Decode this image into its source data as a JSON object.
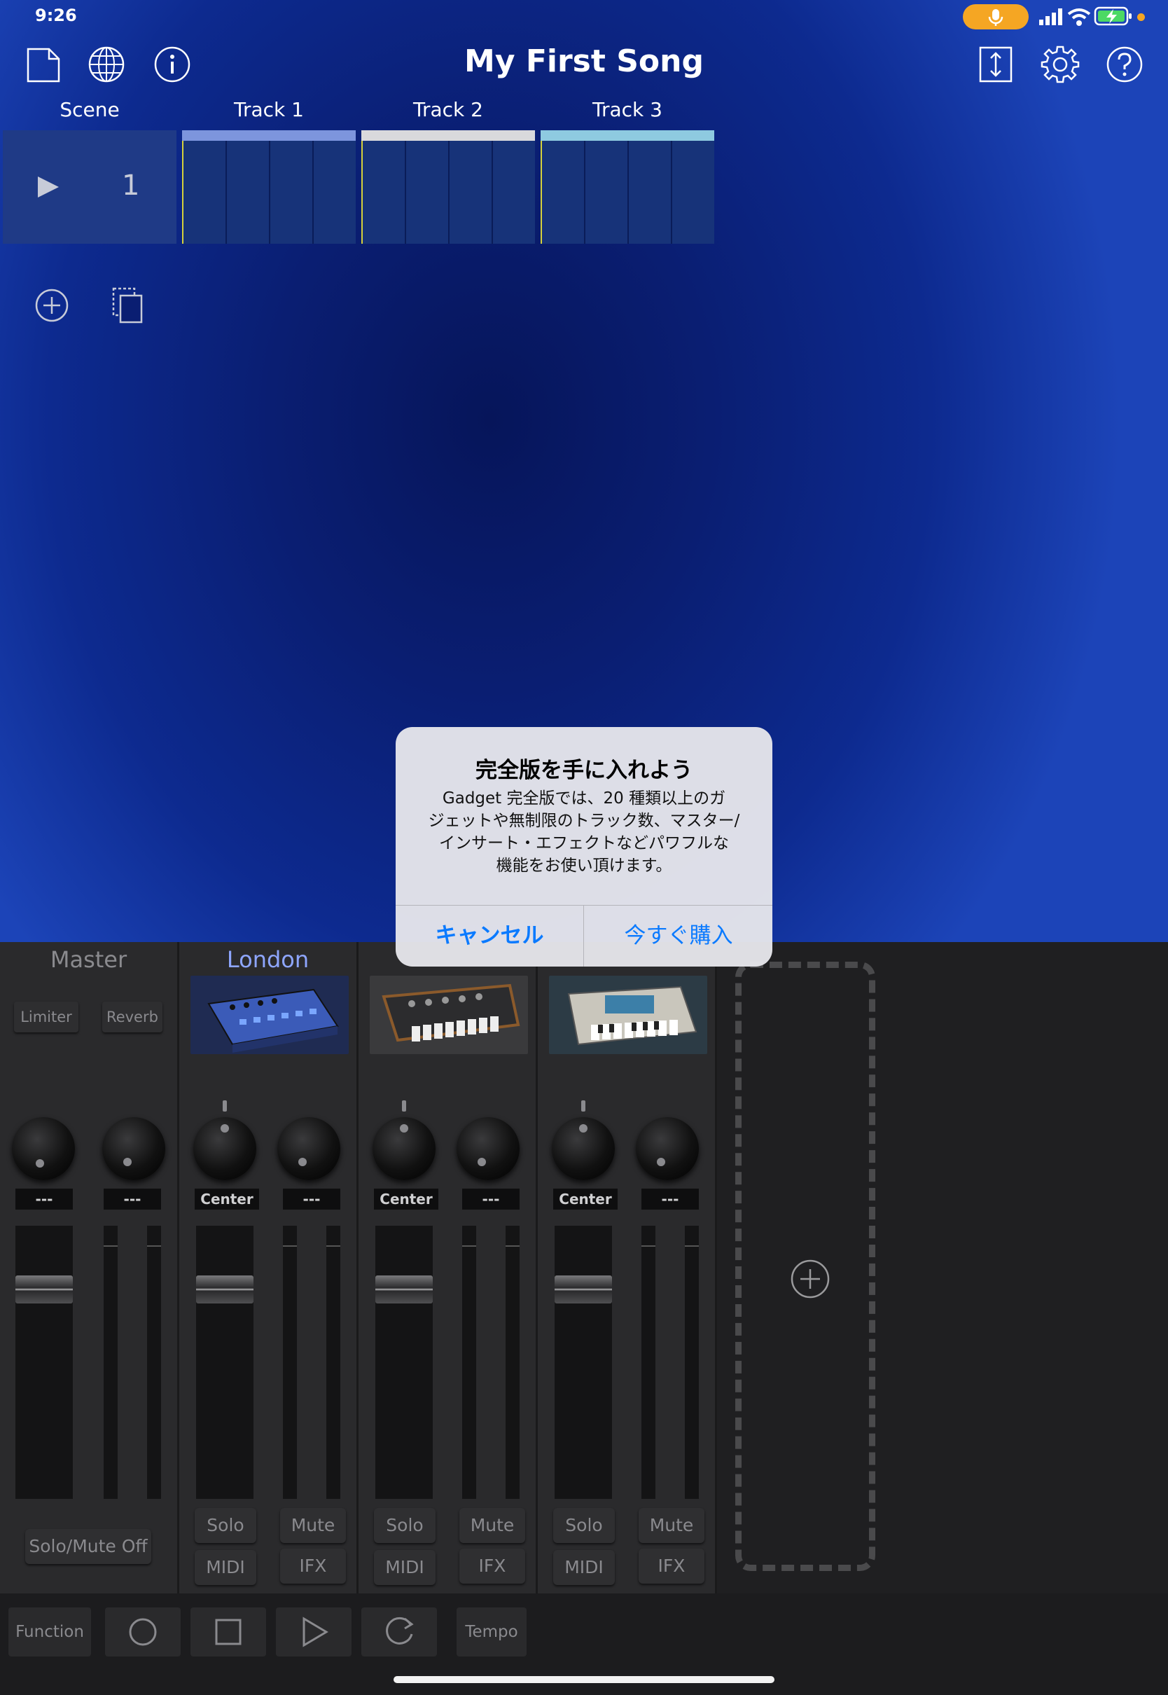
{
  "status_bar": {
    "time": "9:26"
  },
  "header": {
    "title": "My First Song"
  },
  "columns": [
    "Scene",
    "Track 1",
    "Track 2",
    "Track 3"
  ],
  "scene": {
    "number": "1"
  },
  "tracks": [
    {
      "name": "Track 1",
      "color": "#7d95dd"
    },
    {
      "name": "Track 2",
      "color": "#d9d9dc"
    },
    {
      "name": "Track 3",
      "color": "#8ecae0"
    }
  ],
  "mixer": {
    "master": {
      "name": "Master",
      "fx1": "Limiter",
      "fx2": "Reverb",
      "val1": "---",
      "val2": "---",
      "solo_mute_off": "Solo/Mute Off"
    },
    "strips": [
      {
        "name": "London",
        "pan": "Center",
        "send": "---",
        "solo": "Solo",
        "mute": "Mute",
        "midi": "MIDI",
        "ifx": "IFX"
      },
      {
        "name": "",
        "pan": "Center",
        "send": "---",
        "solo": "Solo",
        "mute": "Mute",
        "midi": "MIDI",
        "ifx": "IFX"
      },
      {
        "name": "",
        "pan": "Center",
        "send": "---",
        "solo": "Solo",
        "mute": "Mute",
        "midi": "MIDI",
        "ifx": "IFX"
      }
    ]
  },
  "toolbar": {
    "function": "Function",
    "tempo": "Tempo"
  },
  "dialog": {
    "title": "完全版を手に入れよう",
    "message_lines": [
      "Gadget 完全版では、20 種類以上のガ",
      "ジェットや無制限のトラック数、マスター/",
      "インサート・エフェクトなどパワフルな",
      "機能をお使い頂けます。"
    ],
    "cancel": "キャンセル",
    "buy": "今すぐ購入"
  },
  "colors": {
    "accent_blue": "#0a7aff",
    "mic_badge": "#f5a623",
    "london_label": "#8ea6ff"
  }
}
